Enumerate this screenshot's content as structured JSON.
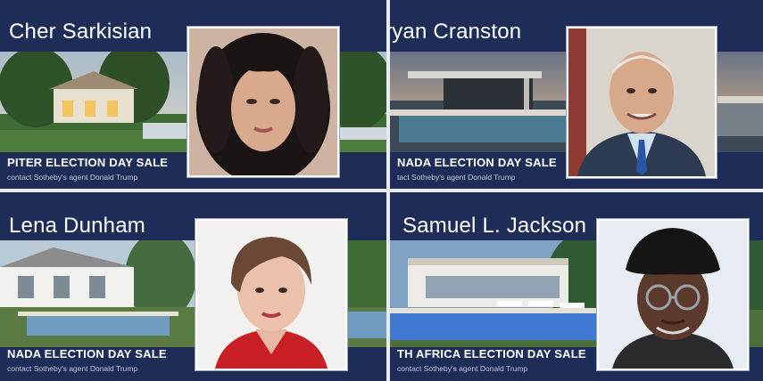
{
  "cards": [
    {
      "name": "Cher Sarkisian",
      "sale": "PITER ELECTION DAY SALE",
      "subtitle": "contact Sotheby's agent Donald Trump",
      "colors": {
        "panel": "#1d2d57"
      }
    },
    {
      "name": "ryan Cranston",
      "sale": "NADA ELECTION DAY SALE",
      "subtitle": "tact Sotheby's agent Donald Trump"
    },
    {
      "name": "Lena Dunham",
      "sale": "NADA ELECTION DAY SALE",
      "subtitle": "contact Sotheby's agent Donald Trump"
    },
    {
      "name": "Samuel L. Jackson",
      "sale": "TH AFRICA ELECTION DAY SALE",
      "subtitle": "contact Sotheby's agent Donald Trump"
    }
  ]
}
